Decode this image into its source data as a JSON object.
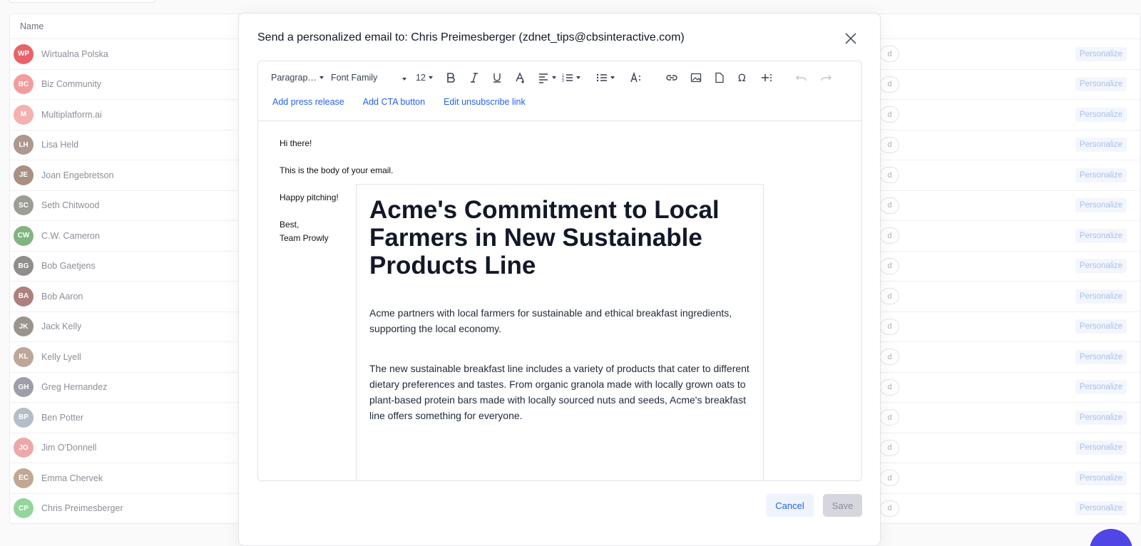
{
  "list": {
    "header": "Name",
    "rows": [
      {
        "name": "Wirtualna Polska",
        "initials": "WP",
        "color": "#e5484d"
      },
      {
        "name": "Biz Community",
        "initials": "BC",
        "color": "#f08c8c"
      },
      {
        "name": "Multiplatform.ai",
        "initials": "M",
        "color": "#f4a3a3"
      },
      {
        "name": "Lisa Held",
        "initials": "LH",
        "color": "#a0867a"
      },
      {
        "name": "Joan Engebretson",
        "initials": "JE",
        "color": "#9b7d6d"
      },
      {
        "name": "Seth Chitwood",
        "initials": "SC",
        "color": "#8d8d84"
      },
      {
        "name": "C.W. Cameron",
        "initials": "CW",
        "color": "#6ca86c"
      },
      {
        "name": "Bob Gaetjens",
        "initials": "BG",
        "color": "#7d7a78"
      },
      {
        "name": "Bob Aaron",
        "initials": "BA",
        "color": "#a06a6a"
      },
      {
        "name": "Jack Kelly",
        "initials": "JK",
        "color": "#8a8278"
      },
      {
        "name": "Kelly Lyell",
        "initials": "KL",
        "color": "#b29888"
      },
      {
        "name": "Greg Hernandez",
        "initials": "GH",
        "color": "#8c8e9c"
      },
      {
        "name": "Ben Potter",
        "initials": "BP",
        "color": "#a9b2bf"
      },
      {
        "name": "Jim O'Donnell",
        "initials": "JO",
        "color": "#e99a9a"
      },
      {
        "name": "Emma Chervek",
        "initials": "EC",
        "color": "#b79a80"
      },
      {
        "name": "Chris Preimesberger",
        "initials": "CP",
        "color": "#7fcf8a"
      }
    ],
    "pill_label": "d",
    "personalize_label": "Personalize"
  },
  "modal": {
    "title": "Send a personalized email to: Chris Preimesberger (zdnet_tips@cbsinteractive.com)",
    "toolbar": {
      "paragraph": "Paragrap…",
      "font_family": "Font Family",
      "font_size": "12"
    },
    "links": {
      "press_release": "Add press release",
      "cta": "Add CTA button",
      "unsubscribe": "Edit unsubscribe link"
    },
    "body": {
      "greeting": "Hi there!",
      "line1": "This is the body of your email.",
      "line2": "Happy pitching!",
      "signoff": "Best,",
      "team": "Team Prowly"
    },
    "press_release": {
      "title": "Acme's Commitment to Local Farmers in New Sustainable Products Line",
      "p1": "Acme partners with local farmers for sustainable and ethical breakfast ingredients, supporting the local economy.",
      "p2": "The new sustainable breakfast line includes a variety of products that cater to different dietary preferences and tastes. From organic granola made with locally grown oats to plant-based protein bars made with locally sourced nuts and seeds, Acme's breakfast line offers something for everyone."
    },
    "cancel_label": "Cancel",
    "save_label": "Save"
  }
}
